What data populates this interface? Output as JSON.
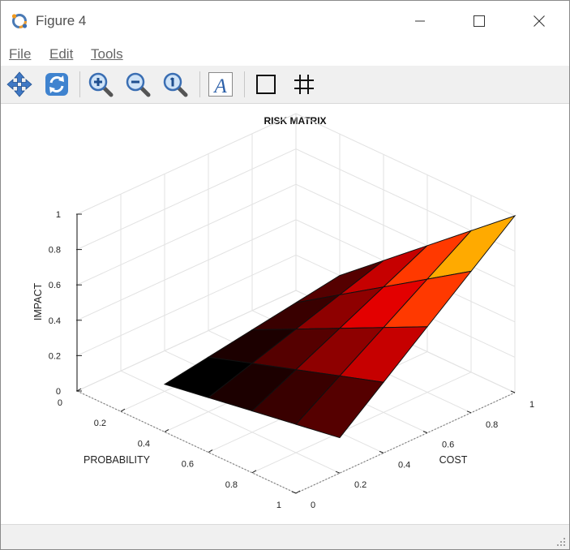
{
  "window": {
    "title": "Figure 4",
    "controls": [
      "minimize",
      "maximize",
      "close"
    ]
  },
  "menu": {
    "file": "File",
    "edit": "Edit",
    "tools": "Tools"
  },
  "toolbar": {
    "buttons": [
      "pan-icon",
      "rotate-icon",
      "zoom-in-icon",
      "zoom-out-icon",
      "zoom-reset-icon",
      "text-icon",
      "axes-box-icon",
      "grid-icon"
    ],
    "text_glyph": "A"
  },
  "chart_data": {
    "type": "surface",
    "title": "RISK MATRIX",
    "xlabel": "PROBABILITY",
    "ylabel": "COST",
    "zlabel": "IMPACT",
    "xlim": [
      0,
      1
    ],
    "ylim": [
      0,
      1
    ],
    "zlim": [
      0,
      1
    ],
    "x_ticks": [
      "0",
      "0.2",
      "0.4",
      "0.6",
      "0.8",
      "1"
    ],
    "y_ticks": [
      "0",
      "0.2",
      "0.4",
      "0.6",
      "0.8",
      "1"
    ],
    "z_ticks": [
      "0",
      "0.2",
      "0.4",
      "0.6",
      "0.8",
      "1"
    ],
    "grid": true,
    "colormap": "hot",
    "surface": {
      "x": [
        0.2,
        0.4,
        0.6,
        0.8,
        1.0
      ],
      "y": [
        0.2,
        0.4,
        0.6,
        0.8,
        1.0
      ],
      "z_formula": "z = x * y",
      "z": [
        [
          0.04,
          0.08,
          0.12,
          0.16,
          0.2
        ],
        [
          0.08,
          0.16,
          0.24,
          0.32,
          0.4
        ],
        [
          0.12,
          0.24,
          0.36,
          0.48,
          0.6
        ],
        [
          0.16,
          0.32,
          0.48,
          0.64,
          0.8
        ],
        [
          0.2,
          0.4,
          0.6,
          0.8,
          1.0
        ]
      ]
    }
  }
}
